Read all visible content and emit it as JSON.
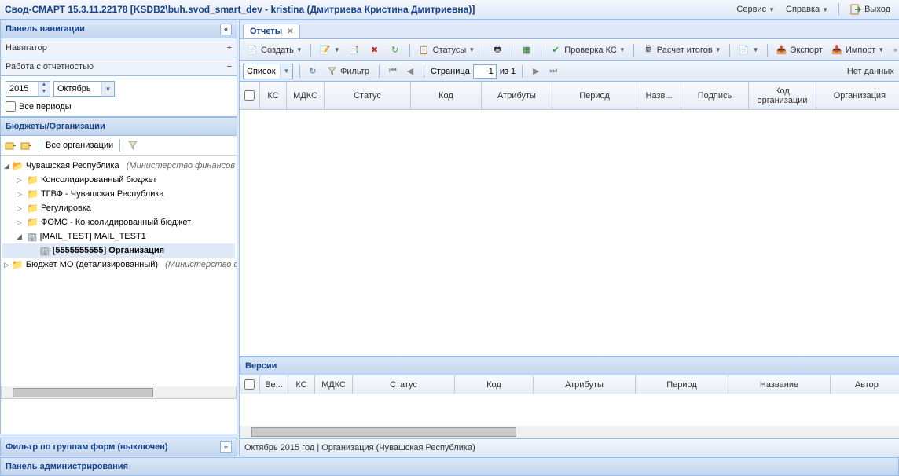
{
  "app": {
    "title": "Свод-СМАРТ 15.3.11.22178 [KSDB2\\buh.svod_smart_dev - kristina (Дмитриева Кристина Дмитриевна)]"
  },
  "header_menu": {
    "service": "Сервис",
    "help": "Справка",
    "exit": "Выход"
  },
  "nav": {
    "title": "Панель навигации",
    "navigator": "Навигатор",
    "reports_section": "Работа с отчетностью",
    "year": "2015",
    "month": "Октябрь",
    "all_periods": "Все периоды",
    "budgets_title": "Бюджеты/Организации",
    "all_orgs": "Все организации",
    "tree": {
      "root1": "Чувашская Республика",
      "root1_note": "(Министерство финансов",
      "n1": "Консолидированный бюджет",
      "n2": "ТГВФ - Чувашская Республика",
      "n3": "Регулировка",
      "n4": "ФОМС - Консолидированный бюджет",
      "n5": "[MAIL_TEST] MAIL_TEST1",
      "n6": "[5555555555] Организация",
      "root2": "Бюджет МО (детализированный)",
      "root2_note": "(Министерство ф"
    },
    "filter_groups": "Фильтр по группам форм (выключен)"
  },
  "main_tab": "Отчеты",
  "toolbar": {
    "create": "Создать",
    "statuses": "Статусы",
    "check_ks": "Проверка КС",
    "calc": "Расчет итогов",
    "export": "Экспорт",
    "import": "Импорт"
  },
  "pagebar": {
    "list": "Список",
    "filter": "Фильтр",
    "page_label": "Страница",
    "page_num": "1",
    "of": "из 1",
    "no_data": "Нет данных"
  },
  "grid": {
    "cols": {
      "chk": "",
      "ks": "КС",
      "mdks": "МДКС",
      "status": "Статус",
      "code": "Код",
      "attrs": "Атрибуты",
      "period": "Период",
      "name": "Назв...",
      "sign": "Подпись",
      "org_code": "Код организации",
      "org": "Организация"
    }
  },
  "versions": {
    "title": "Версии",
    "cols": {
      "ver": "Ве...",
      "ks": "КС",
      "mdks": "МДКС",
      "status": "Статус",
      "code": "Код",
      "attrs": "Атрибуты",
      "period": "Период",
      "name": "Название",
      "author": "Автор"
    }
  },
  "status_text": "Октябрь 2015 год | Организация (Чувашская Республика)",
  "footer": "Панель администрирования"
}
